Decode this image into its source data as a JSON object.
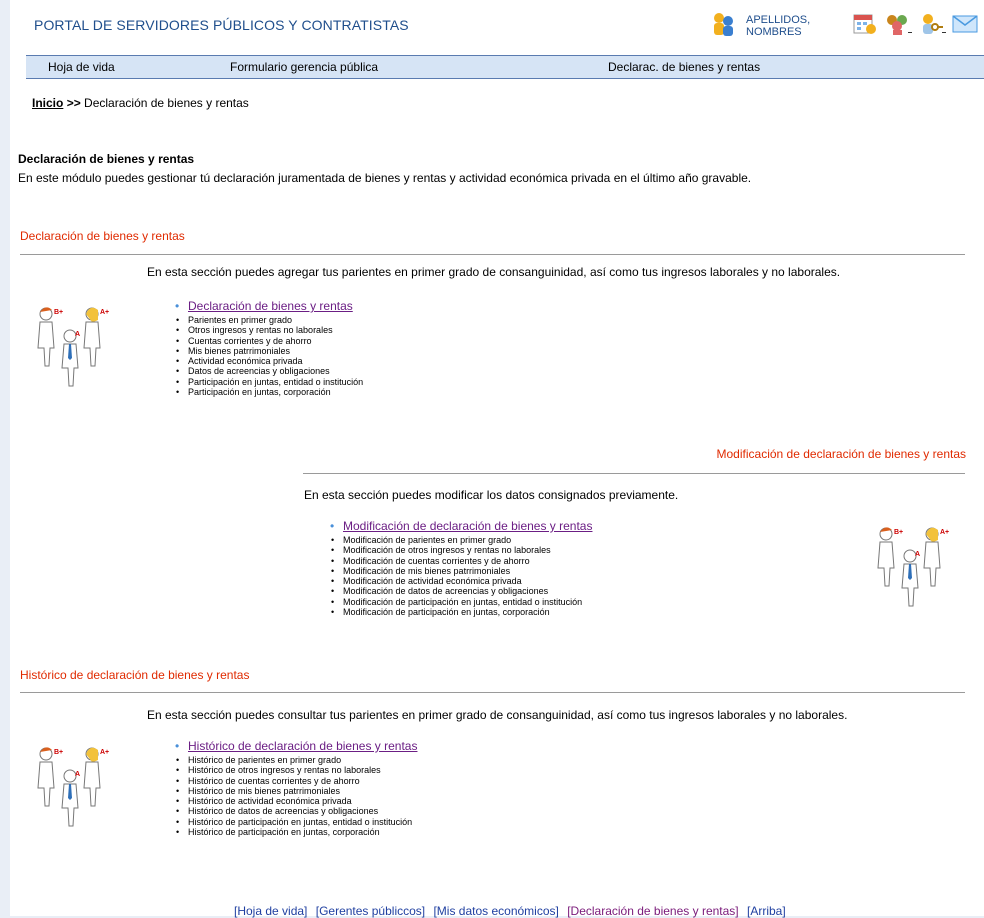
{
  "header": {
    "portal_title": "PORTAL DE SERVIDORES PÚBLICOS Y CONTRATISTAS",
    "user_name": "APELLIDOS, NOMBRES"
  },
  "menu": {
    "item1": "Hoja de vida",
    "item2": "Formulario gerencia pública",
    "item3": "Declarac. de bienes y rentas"
  },
  "breadcrumb": {
    "home": "Inicio",
    "separator": ">>",
    "current": "Declaración de bienes y rentas"
  },
  "intro": {
    "title": "Declaración de bienes y rentas",
    "text": "En este módulo puedes gestionar tú declaración juramentada de bienes y rentas y actividad económica privada en el último año gravable."
  },
  "section1": {
    "title": "Declaración de bienes y rentas",
    "description": "En esta sección puedes agregar tus parientes en primer grado de consanguinidad, así como tus ingresos laborales y no laborales.",
    "main_link": "Declaración de bienes y rentas",
    "items": [
      "Parientes en primer grado",
      "Otros ingresos y rentas no laborales",
      "Cuentas corrientes y de ahorro",
      "Mis bienes patrrimoniales",
      "Actividad económica privada",
      "Datos de acreencias y obligaciones",
      "Participación en juntas, entidad o institución",
      "Participación en juntas, corporación"
    ]
  },
  "section2": {
    "title": "Modificación de declaración de bienes y rentas",
    "description": "En esta sección puedes modificar los datos consignados previamente.",
    "main_link": "Modificación de declaración de bienes y rentas",
    "items": [
      "Modificación de parientes en primer grado",
      "Modificación de otros ingresos y rentas no laborales",
      "Modificación de cuentas corrientes y de ahorro",
      "Modificación de mis bienes patrrimoniales",
      "Modificación de actividad económica privada",
      "Modificación de datos de acreencias y obligaciones",
      "Modificación de participación en juntas, entidad o institución",
      "Modificación de participación en juntas, corporación"
    ]
  },
  "section3": {
    "title": "Histórico de declaración de bienes y rentas",
    "description": "En esta sección puedes consultar tus parientes en primer grado de consanguinidad, así como tus ingresos laborales y no laborales.",
    "main_link": "Histórico de declaración de bienes y rentas",
    "items": [
      "Histórico de parientes en primer grado",
      "Histórico de otros ingresos y rentas no laborales",
      "Histórico de cuentas corrientes y de ahorro",
      "Histórico de mis bienes patrrimoniales",
      "Histórico de actividad económica privada",
      "Histórico de datos de acreencias y obligaciones",
      "Histórico de participación en juntas, entidad o institución",
      "Histórico de participación en juntas, corporación"
    ]
  },
  "figure_labels": {
    "b_plus": "B+",
    "a_plus": "A+",
    "a": "A"
  },
  "footer": {
    "links": [
      "[Hoja de vida]",
      "[Gerentes públiccos]",
      "[Mis datos económicos]",
      "[Declaración de bienes y rentas]",
      "[Arriba]"
    ]
  },
  "colors": {
    "accent_blue": "#1f4e8c",
    "section_title": "#e02a00",
    "visited_link": "#6b1e84",
    "menubar_bg": "#d6e4f5"
  }
}
